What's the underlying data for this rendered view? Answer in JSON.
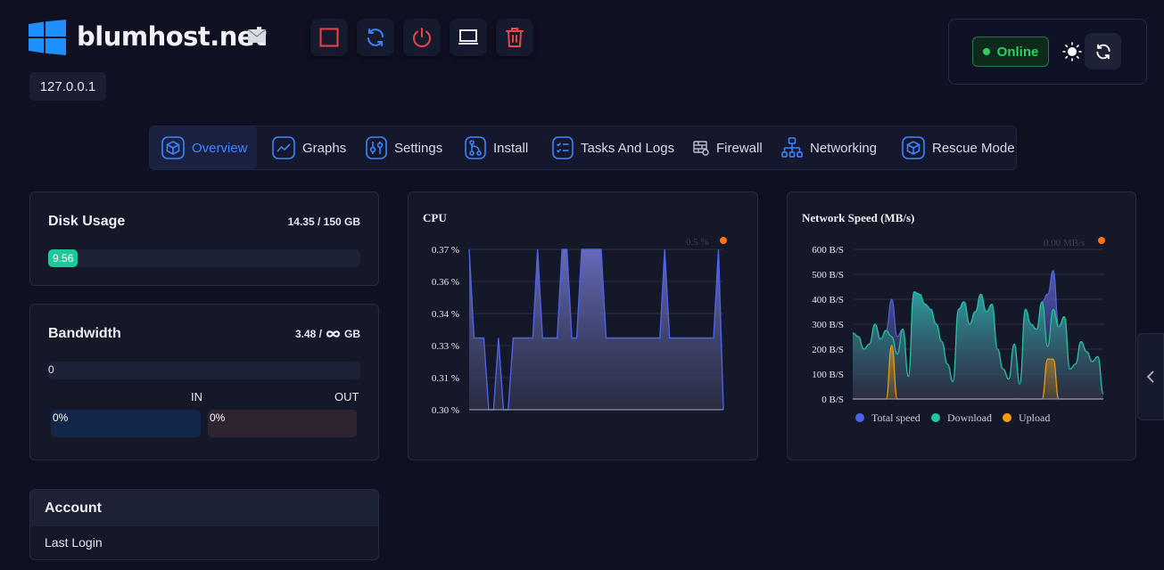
{
  "header": {
    "site_name": "blumhost.net",
    "ip_address": "127.0.0.1",
    "actions": [
      {
        "name": "stop",
        "icon": "stop-icon",
        "color": "#ef4444"
      },
      {
        "name": "restart",
        "icon": "restart-icon",
        "color": "#3b82f6"
      },
      {
        "name": "power",
        "icon": "power-icon",
        "color": "#ef4444"
      },
      {
        "name": "console",
        "icon": "laptop-icon",
        "color": "#ffffff"
      },
      {
        "name": "delete",
        "icon": "trash-icon",
        "color": "#ef4444"
      }
    ]
  },
  "status": {
    "label": "Online",
    "color": "#2fcf63"
  },
  "tabs": [
    {
      "label": "Overview",
      "icon": "cube-icon",
      "active": true
    },
    {
      "label": "Graphs",
      "icon": "line-chart-icon"
    },
    {
      "label": "Settings",
      "icon": "sliders-icon"
    },
    {
      "label": "Install",
      "icon": "git-icon"
    },
    {
      "label": "Tasks And Logs",
      "icon": "checklist-icon"
    },
    {
      "label": "Firewall",
      "icon": "firewall-icon"
    },
    {
      "label": "Networking",
      "icon": "network-icon"
    },
    {
      "label": "Rescue Mode",
      "icon": "rescue-icon"
    }
  ],
  "disk": {
    "title": "Disk Usage",
    "usage": "14.35 / 150 GB",
    "bar_label": "9.56",
    "percent": 9.56
  },
  "bandwidth": {
    "title": "Bandwidth",
    "usage_prefix": "3.48 /",
    "usage_suffix": "GB",
    "bar_value": "0",
    "in_label": "IN",
    "out_label": "OUT",
    "in_value": "0%",
    "out_value": "0%"
  },
  "account": {
    "title": "Account",
    "last_login_label": "Last Login"
  },
  "cpu_chart": {
    "title": "CPU",
    "legend_value": "0.5 %"
  },
  "network_chart": {
    "title": "Network Speed (MB/s)",
    "legend_value": "0.00 MB/s",
    "legend": [
      "Total speed",
      "Download",
      "Upload"
    ]
  },
  "colors": {
    "accent": "#3d84ff",
    "total": "#4b63e8",
    "download": "#1fc79a",
    "upload": "#f59e0b",
    "marker": "#f97316"
  },
  "chart_data": [
    {
      "type": "area",
      "title": "CPU",
      "yticks": [
        "0.37 %",
        "0.36 %",
        "0.34 %",
        "0.33 %",
        "0.31 %",
        "0.30 %"
      ],
      "ylim": [
        0.3,
        0.37
      ],
      "series": [
        {
          "values": [
            0.37,
            0.3313,
            0.3313,
            0.3313,
            0.3,
            0.3,
            0.3313,
            0.3,
            0.3,
            0.3313,
            0.3313,
            0.3313,
            0.3313,
            0.3313,
            0.37,
            0.3313,
            0.3313,
            0.3313,
            0.3313,
            0.37,
            0.37,
            0.3313,
            0.3313,
            0.37,
            0.37,
            0.37,
            0.37,
            0.37,
            0.3313,
            0.3313,
            0.3313,
            0.3313,
            0.3313,
            0.3313,
            0.3313,
            0.3313,
            0.3313,
            0.3313,
            0.3313,
            0.3313,
            0.37,
            0.3313,
            0.3313,
            0.3313,
            0.3313,
            0.3313,
            0.3313,
            0.3313,
            0.3313,
            0.3313,
            0.3313,
            0.37,
            0.3
          ]
        }
      ],
      "grid": true
    },
    {
      "type": "area",
      "title": "Network Speed (MB/s)",
      "yticks": [
        "600 B/S",
        "500 B/S",
        "400 B/S",
        "300 B/S",
        "200 B/S",
        "100 B/S",
        "0 B/S"
      ],
      "ylim": [
        0,
        600
      ],
      "series": [
        {
          "name": "Total speed",
          "values": [
            265,
            250,
            200,
            220,
            300,
            240,
            275,
            400,
            250,
            280,
            90,
            430,
            420,
            380,
            360,
            300,
            230,
            140,
            70,
            360,
            390,
            300,
            350,
            420,
            350,
            380,
            200,
            120,
            80,
            220,
            60,
            360,
            300,
            280,
            390,
            420,
            515,
            290,
            330,
            120,
            140,
            230,
            190,
            150,
            170,
            20
          ]
        },
        {
          "name": "Download",
          "values": [
            265,
            250,
            200,
            220,
            300,
            240,
            275,
            250,
            180,
            280,
            90,
            430,
            420,
            380,
            360,
            300,
            230,
            140,
            70,
            360,
            390,
            300,
            350,
            420,
            350,
            380,
            200,
            120,
            80,
            220,
            60,
            360,
            300,
            280,
            390,
            210,
            360,
            290,
            330,
            120,
            140,
            230,
            190,
            150,
            170,
            20
          ]
        },
        {
          "name": "Upload",
          "values": [
            0,
            0,
            0,
            0,
            0,
            0,
            0,
            215,
            0,
            0,
            0,
            0,
            0,
            0,
            0,
            0,
            0,
            0,
            0,
            0,
            0,
            0,
            0,
            0,
            0,
            0,
            0,
            0,
            0,
            0,
            0,
            0,
            0,
            0,
            0,
            160,
            160,
            0,
            0,
            0,
            0,
            0,
            0,
            0,
            0,
            0
          ]
        }
      ],
      "grid": true,
      "legend_position": "bottom"
    }
  ]
}
